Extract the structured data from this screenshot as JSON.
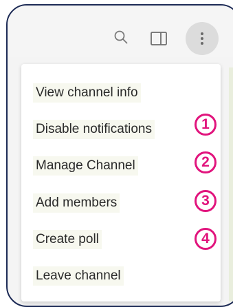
{
  "toolbar": {
    "icons": [
      "search-icon",
      "side-panel-icon",
      "more-vertical-icon"
    ]
  },
  "menu": {
    "items": [
      {
        "label": "View channel info"
      },
      {
        "label": "Disable notifications",
        "badge": "1"
      },
      {
        "label": "Manage Channel",
        "badge": "2"
      },
      {
        "label": "Add members",
        "badge": "3"
      },
      {
        "label": "Create poll",
        "badge": "4"
      },
      {
        "label": "Leave channel"
      }
    ]
  },
  "colors": {
    "frame_border": "#1c2a55",
    "badge": "#e1147d",
    "more_button_bg": "#dcdcdc"
  }
}
